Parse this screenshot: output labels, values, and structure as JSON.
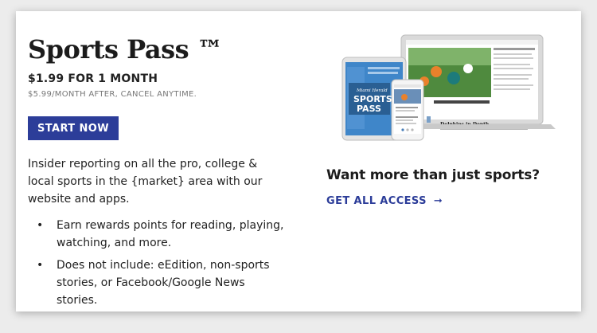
{
  "offer": {
    "title": "Sports Pass ™",
    "price_line": "$1.99 FOR 1 MONTH",
    "price_sub": "$5.99/MONTH AFTER, CANCEL ANYTIME.",
    "start_button": "START NOW",
    "description": "Insider reporting on all the pro, college & local sports in the {market} area with our website and apps.",
    "bullets": [
      "Earn rewards points for reading, playing, watching, and more.",
      "Does not include: eEdition, non-sports stories, or Facebook/Google News stories."
    ],
    "bullet_glyph": "•"
  },
  "upsell": {
    "heading": "Want more than just sports?",
    "link_label": "GET ALL ACCESS",
    "link_arrow": "➞"
  },
  "devices_image": {
    "tablet_lines": [
      "Miami Herald",
      "SPORTS",
      "PASS"
    ],
    "article_headline": "Dolphins in Depth"
  },
  "colors": {
    "accent": "#2c3d99",
    "tablet_blue": "#3f86c9"
  }
}
